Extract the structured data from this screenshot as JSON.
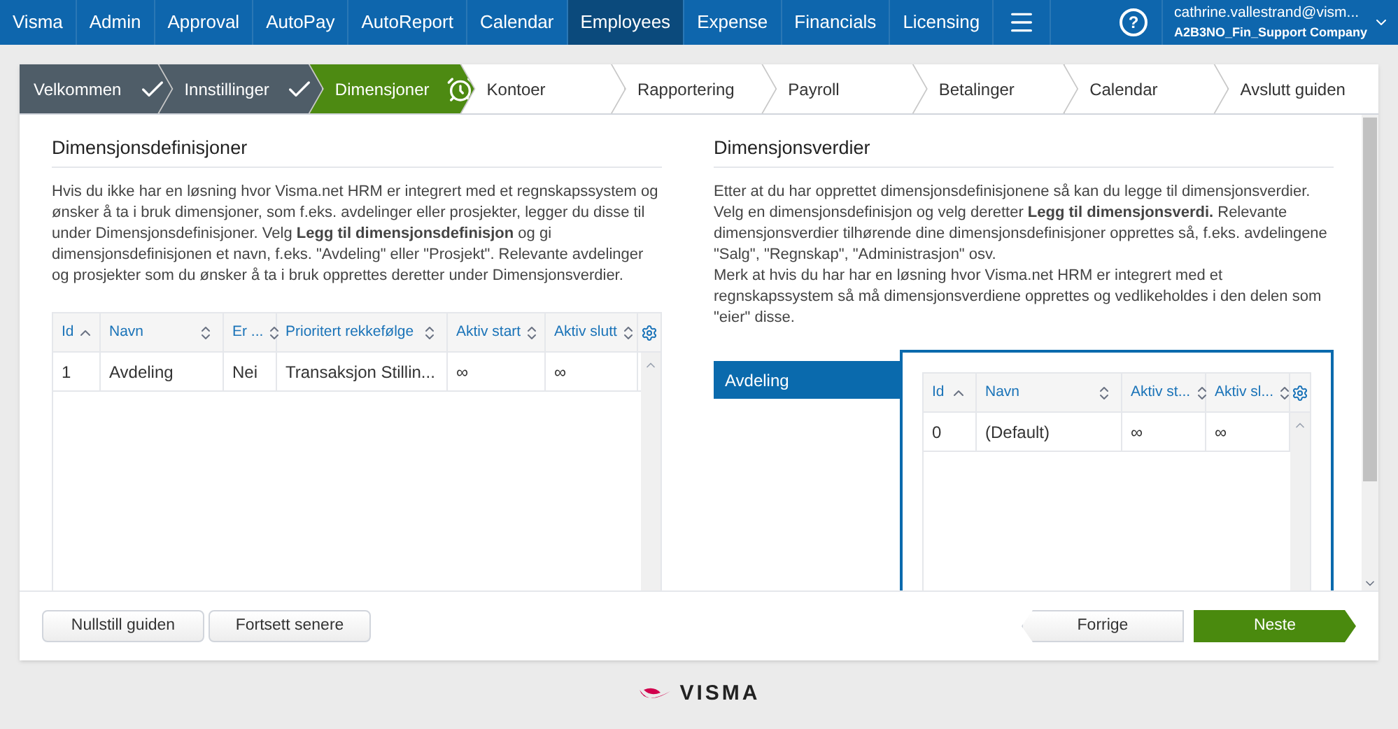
{
  "nav": {
    "items": [
      {
        "label": "Visma",
        "selected": false
      },
      {
        "label": "Admin",
        "selected": false
      },
      {
        "label": "Approval",
        "selected": false
      },
      {
        "label": "AutoPay",
        "selected": false
      },
      {
        "label": "AutoReport",
        "selected": false
      },
      {
        "label": "Calendar",
        "selected": false
      },
      {
        "label": "Employees",
        "selected": true
      },
      {
        "label": "Expense",
        "selected": false
      },
      {
        "label": "Financials",
        "selected": false
      },
      {
        "label": "Licensing",
        "selected": false
      }
    ],
    "help": "?",
    "user": {
      "email": "cathrine.vallestrand@vism...",
      "company": "A2B3NO_Fin_Support Company"
    }
  },
  "steps": [
    {
      "label": "Velkommen",
      "done": true,
      "selected": false
    },
    {
      "label": "Innstillinger",
      "done": true,
      "selected": false
    },
    {
      "label": "Dimensjoner",
      "done": false,
      "selected": true
    },
    {
      "label": "Kontoer",
      "done": false,
      "selected": false
    },
    {
      "label": "Rapportering",
      "done": false,
      "selected": false
    },
    {
      "label": "Payroll",
      "done": false,
      "selected": false
    },
    {
      "label": "Betalinger",
      "done": false,
      "selected": false
    },
    {
      "label": "Calendar",
      "done": false,
      "selected": false
    },
    {
      "label": "Avslutt guiden",
      "done": false,
      "selected": false
    }
  ],
  "definitions": {
    "title": "Dimensjonsdefinisjoner",
    "text": "Hvis du ikke har en løsning hvor Visma.net HRM er integrert med et regnskapssystem og ønsker å ta i bruk dimensjoner, som f.eks. avdelinger eller prosjekter, legger du disse til under Dimensjonsdefinisjoner. Velg **Legg til dimensjonsdefinisjon** og gi dimensjonsdefinisjonen et navn, f.eks. \"Avdeling\" eller \"Prosjekt\". Relevante avdelinger og prosjekter som du ønsker å ta i bruk opprettes deretter under Dimensjonsverdier.",
    "table": {
      "columns": [
        {
          "label": "Id",
          "sorted": true
        },
        {
          "label": "Navn",
          "sorted": false
        },
        {
          "label": "Er ...",
          "sorted": false
        },
        {
          "label": "Prioritert rekkefølge",
          "sorted": false
        },
        {
          "label": "Aktiv start",
          "sorted": false
        },
        {
          "label": "Aktiv slutt",
          "sorted": false
        }
      ],
      "rows": [
        [
          "1",
          "Avdeling",
          "Nei",
          "Transaksjon Stillin...",
          "∞",
          "∞"
        ]
      ]
    }
  },
  "values": {
    "title": "Dimensjonsverdier",
    "paragraphs": [
      "Etter at du har opprettet dimensjonsdefinisjonene så kan du legge til dimensjonsverdier. Velg en dimensjonsdefinisjon og velg deretter **Legg til dimensjonsverdi.** Relevante dimensjonsverdier tilhørende dine dimensjonsdefinisjoner opprettes så, f.eks. avdelingene \"Salg\", \"Regnskap\", \"Administrasjon\" osv.",
      "Merk at hvis du har har en løsning hvor Visma.net HRM er integrert med et regnskapssystem så må dimensjonsverdiene opprettes og vedlikeholdes i den delen som \"eier\" disse."
    ],
    "list": [
      {
        "label": "Avdeling",
        "selected": true
      }
    ],
    "table": {
      "columns": [
        {
          "label": "Id",
          "sorted": true
        },
        {
          "label": "Navn",
          "sorted": false
        },
        {
          "label": "Aktiv st...",
          "sorted": false
        },
        {
          "label": "Aktiv sl...",
          "sorted": false
        }
      ],
      "rows": [
        [
          "0",
          "(Default)",
          "∞",
          "∞"
        ]
      ]
    }
  },
  "footer": {
    "left_buttons": [
      "Nullstill guiden",
      "Fortsett senere"
    ],
    "previous": "Forrige",
    "next": "Neste"
  },
  "logo": "VISMA"
}
